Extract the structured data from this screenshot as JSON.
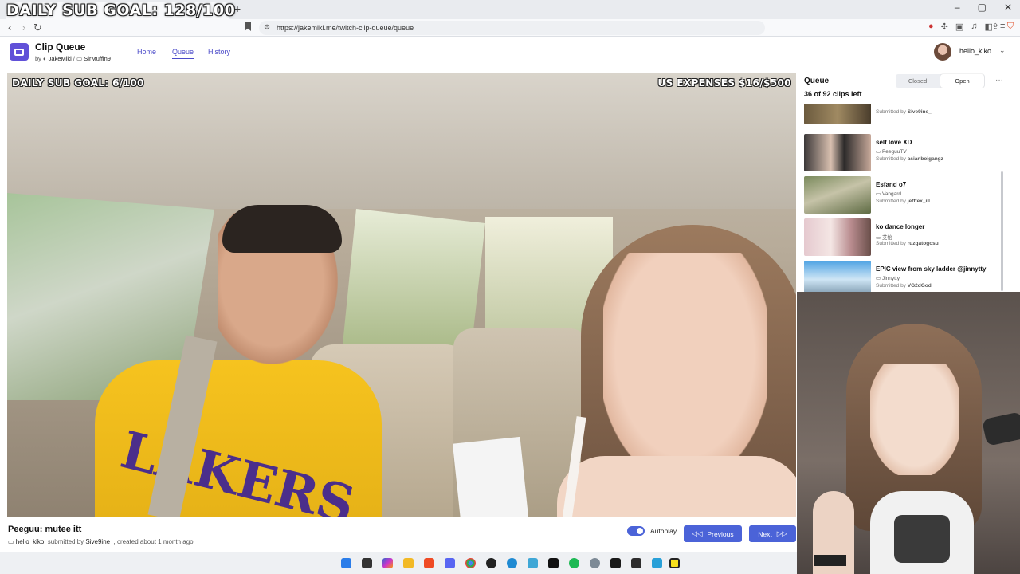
{
  "browser": {
    "overlay_goal": "DAILY SUB GOAL: 128/100",
    "tab_close": "×",
    "new_tab": "+",
    "url": "https://jakemiki.me/twitch-clip-queue/queue",
    "window_buttons": [
      "–",
      "▢",
      "✕"
    ]
  },
  "app": {
    "title": "Clip Queue",
    "by_prefix": "by",
    "author": "JakeMiki",
    "separator": "/",
    "channel": "SirMuffin9",
    "nav": [
      "Home",
      "Queue",
      "History"
    ],
    "active_nav": "Queue",
    "user": "hello_kiko"
  },
  "video": {
    "overlay_left": "DAILY SUB GOAL: 6/100",
    "overlay_right": "US EXPENSES $16/$500",
    "jersey": "LAKERS"
  },
  "clip": {
    "title": "Peeguu: mutee itt",
    "channel": "hello_kiko",
    "submitted_prefix": ", submitted by",
    "submitter": "Sive9ine_",
    "created": ", created about 1 month ago"
  },
  "controls": {
    "autoplay_label": "Autoplay",
    "autoplay_on": true,
    "previous_label": "Previous",
    "next_label": "Next"
  },
  "queue": {
    "title": "Queue",
    "count": "36 of 92 clips left",
    "closed_label": "Closed",
    "open_label": "Open",
    "more": "···",
    "items": [
      {
        "name": "",
        "channel": "",
        "submitted_prefix": "Submitted by",
        "submitter": "Sive9ine_"
      },
      {
        "name": "self love XD",
        "channel": "PeeguuTV",
        "submitted_prefix": "Submitted by",
        "submitter": "asianboigangz"
      },
      {
        "name": "Esfand o7",
        "channel": "Vangard",
        "submitted_prefix": "Submitted by",
        "submitter": "jefftex_ill"
      },
      {
        "name": "ko dance longer",
        "channel": "艾怡",
        "submitted_prefix": "Submitted by",
        "submitter": "ruzgatogosu"
      },
      {
        "name": "EPIC view from sky ladder @jinnytty",
        "channel": "Jinnytty",
        "submitted_prefix": "Submitted by",
        "submitter": "VG2dGod"
      }
    ]
  },
  "colors": {
    "accent": "#4b63d8",
    "logo": "#6151d8",
    "link": "#4a4ac9"
  }
}
